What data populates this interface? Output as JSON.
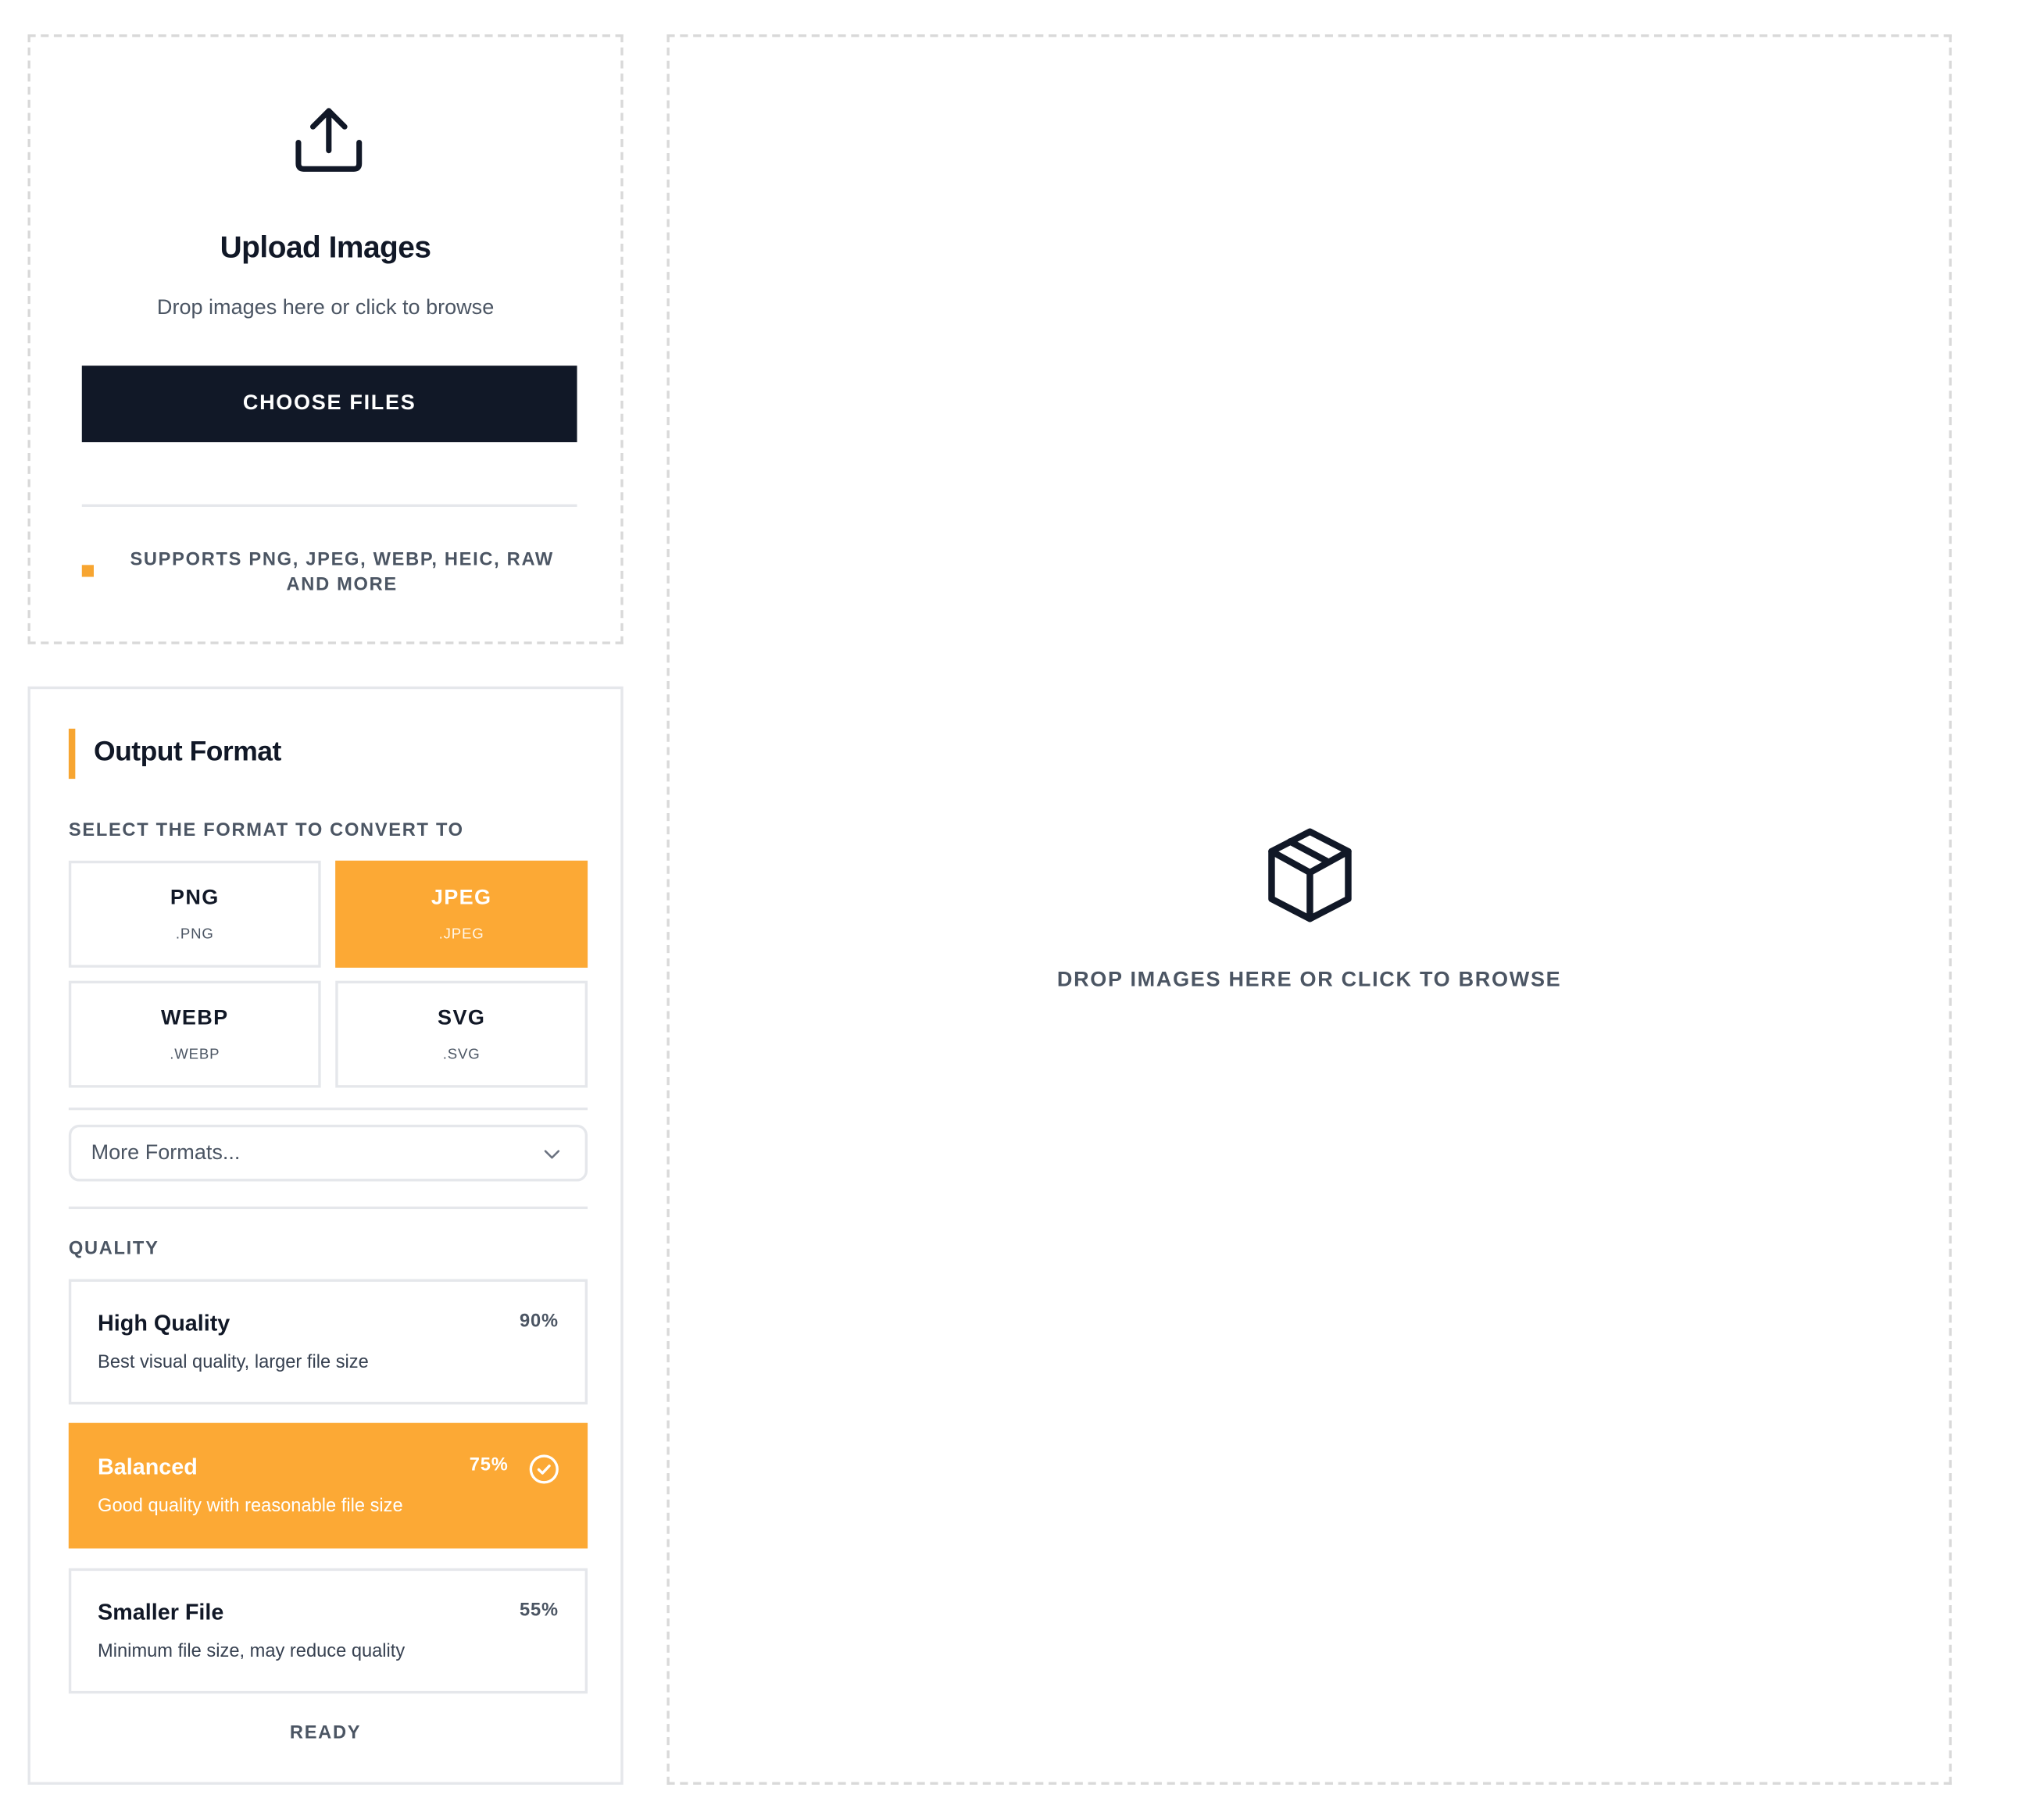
{
  "upload": {
    "icon": "upload-icon",
    "title": "Upload Images",
    "subtitle": "Drop images here or click to browse",
    "button_label": "CHOOSE FILES",
    "supports_text": "SUPPORTS PNG, JPEG, WEBP, HEIC, RAW AND MORE"
  },
  "output_format": {
    "title": "Output Format",
    "select_label": "SELECT THE FORMAT TO CONVERT TO",
    "formats": [
      {
        "name": "PNG",
        "ext": ".PNG",
        "selected": false
      },
      {
        "name": "JPEG",
        "ext": ".JPEG",
        "selected": true
      },
      {
        "name": "WEBP",
        "ext": ".WEBP",
        "selected": false
      },
      {
        "name": "SVG",
        "ext": ".SVG",
        "selected": false
      }
    ],
    "more_formats_label": "More Formats...",
    "quality_label": "QUALITY",
    "quality_options": [
      {
        "name": "High Quality",
        "description": "Best visual quality, larger file size",
        "percent": "90%",
        "selected": false
      },
      {
        "name": "Balanced",
        "description": "Good quality with reasonable file size",
        "percent": "75%",
        "selected": true
      },
      {
        "name": "Smaller File",
        "description": "Minimum file size, may reduce quality",
        "percent": "55%",
        "selected": false
      }
    ],
    "status": "READY"
  },
  "dropzone": {
    "icon": "package-icon",
    "text": "DROP IMAGES HERE OR CLICK TO BROWSE"
  },
  "colors": {
    "accent": "#fca935",
    "dark": "#111827",
    "muted_text": "#4b5563",
    "border": "#e5e7eb"
  }
}
